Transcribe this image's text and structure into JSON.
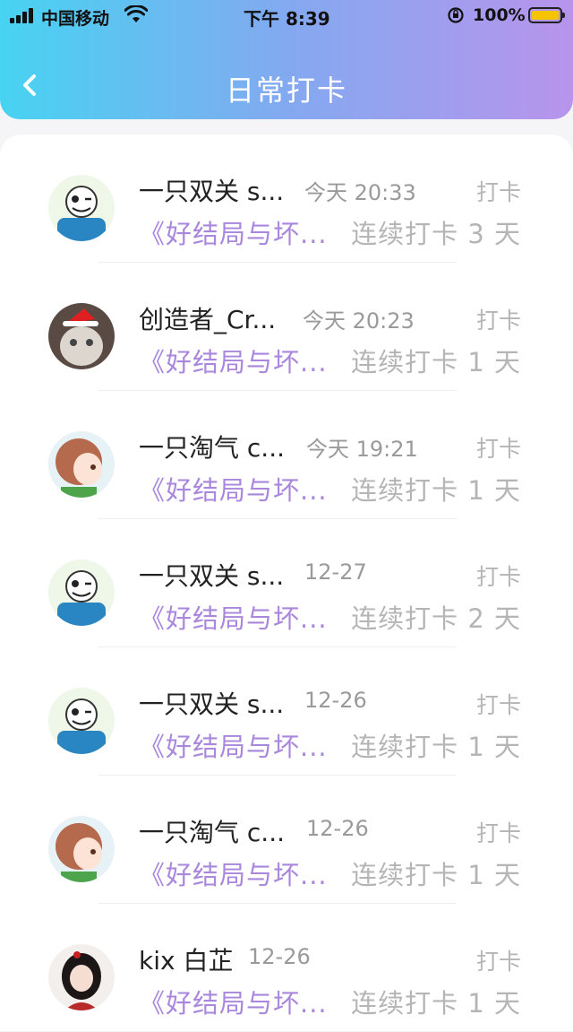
{
  "status_bar": {
    "carrier": "中国移动",
    "time": "下午 8:39",
    "battery": "100%"
  },
  "header": {
    "title": "日常打卡",
    "back_icon": "chevron-left-icon"
  },
  "colors": {
    "gradient_start": "#47d3f2",
    "gradient_end": "#b894ec",
    "accent_purple": "#a987dd",
    "muted_gray": "#b5b5b5"
  },
  "records": [
    {
      "name": "一只双关 s...",
      "date": "今天 20:33",
      "tag": "打卡",
      "activity": "《好结局与坏...",
      "streak": "连续打卡 3 天",
      "avatar": "skeleton-avatar"
    },
    {
      "name": "创造者_Cr...",
      "date": "今天 20:23",
      "tag": "打卡",
      "activity": "《好结局与坏...",
      "streak": "连续打卡 1 天",
      "avatar": "cat-santa-hat-avatar"
    },
    {
      "name": "一只淘气 c...",
      "date": "今天 19:21",
      "tag": "打卡",
      "activity": "《好结局与坏...",
      "streak": "连续打卡 1 天",
      "avatar": "brown-hair-girl-avatar"
    },
    {
      "name": "一只双关 s...",
      "date": "12-27",
      "tag": "打卡",
      "activity": "《好结局与坏...",
      "streak": "连续打卡 2 天",
      "avatar": "skeleton-avatar"
    },
    {
      "name": "一只双关 s...",
      "date": "12-26",
      "tag": "打卡",
      "activity": "《好结局与坏...",
      "streak": "连续打卡 1 天",
      "avatar": "skeleton-avatar"
    },
    {
      "name": "一只淘气 c...",
      "date": "12-26",
      "tag": "打卡",
      "activity": "《好结局与坏...",
      "streak": "连续打卡 1 天",
      "avatar": "brown-hair-girl-avatar"
    },
    {
      "name": "kix 白芷",
      "date": "12-26",
      "tag": "打卡",
      "activity": "《好结局与坏...",
      "streak": "连续打卡 1 天",
      "avatar": "dark-hair-girl-avatar"
    }
  ]
}
